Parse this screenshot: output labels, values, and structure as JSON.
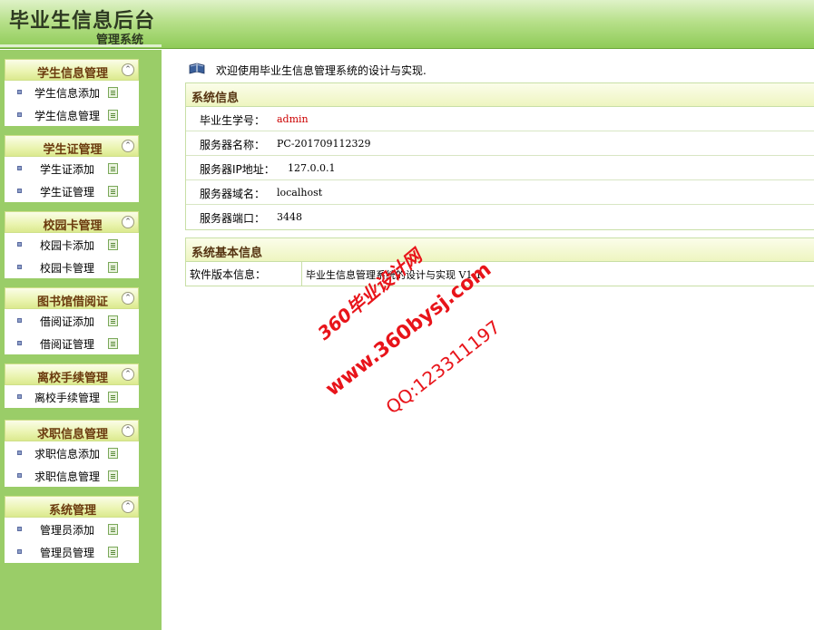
{
  "header": {
    "title": "毕业生信息后台",
    "subtitle": "管理系统"
  },
  "sidebar": {
    "groups": [
      {
        "title": "学生信息管理",
        "items": [
          "学生信息添加",
          "学生信息管理"
        ]
      },
      {
        "title": "学生证管理",
        "items": [
          "学生证添加",
          "学生证管理"
        ]
      },
      {
        "title": "校园卡管理",
        "items": [
          "校园卡添加",
          "校园卡管理"
        ]
      },
      {
        "title": "图书馆借阅证",
        "items": [
          "借阅证添加",
          "借阅证管理"
        ]
      },
      {
        "title": "离校手续管理",
        "items": [
          "离校手续管理"
        ]
      },
      {
        "title": "求职信息管理",
        "items": [
          "求职信息添加",
          "求职信息管理"
        ]
      },
      {
        "title": "系统管理",
        "items": [
          "管理员添加",
          "管理员管理"
        ]
      }
    ]
  },
  "main": {
    "welcome": "欢迎使用毕业生信息管理系统的设计与实现.",
    "system_info": {
      "title": "系统信息",
      "rows": [
        {
          "label": "毕业生学号：",
          "value": "admin",
          "color": "#cc0000"
        },
        {
          "label": "服务器名称：",
          "value": "PC-201709112329",
          "color": "#000000"
        },
        {
          "label": "服务器IP地址：",
          "value": "127.0.0.1",
          "color": "#000000"
        },
        {
          "label": "服务器域名：",
          "value": "localhost",
          "color": "#000000"
        },
        {
          "label": "服务器端口：",
          "value": "3448",
          "color": "#000000"
        }
      ]
    },
    "basic_info": {
      "title": "系统基本信息",
      "label": "软件版本信息：",
      "value": "毕业生信息管理系统的设计与实现 V1.1"
    }
  },
  "watermark": {
    "line1": "360毕业设计网",
    "line2": "www.360bysj.com",
    "line3": "QQ:123311197",
    "color": "#e8141a"
  }
}
